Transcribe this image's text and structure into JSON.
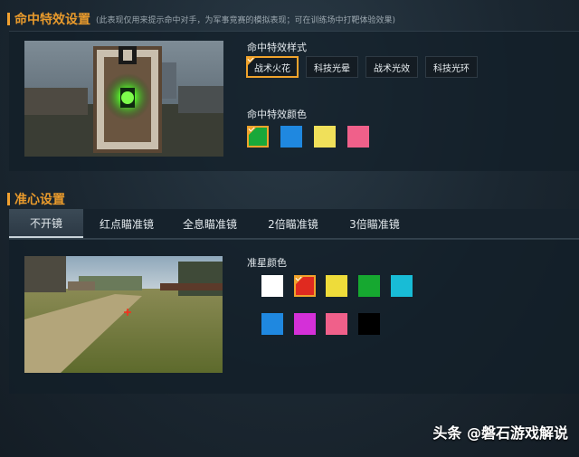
{
  "hit_effect": {
    "title": "命中特效设置",
    "note": "(此表现仅用来提示命中对手，为军事竞赛的模拟表现；可在训练场中打靶体验效果)",
    "style_label": "命中特效样式",
    "styles": [
      "战术火花",
      "科技光晕",
      "战术光效",
      "科技光环"
    ],
    "selected_style": "战术火花",
    "color_label": "命中特效颜色",
    "colors": [
      "#19a83a",
      "#1f88e0",
      "#f0e05a",
      "#f0608a"
    ],
    "selected_color": "#19a83a",
    "preview_icon": "target-board-icon"
  },
  "crosshair": {
    "title": "准心设置",
    "tabs": [
      "不开镜",
      "红点瞄准镜",
      "全息瞄准镜",
      "2倍瞄准镜",
      "3倍瞄准镜"
    ],
    "active_tab": "不开镜",
    "color_label": "准星颜色",
    "colors": [
      "#ffffff",
      "#e02a20",
      "#eedc3a",
      "#16a830",
      "#18bcd6",
      "#1f88e0",
      "#d430d8",
      "#f0608a",
      "#000000"
    ],
    "selected_color": "#e02a20",
    "preview_icon": "crosshair-icon"
  },
  "watermark": "头条 @磐石游戏解说"
}
